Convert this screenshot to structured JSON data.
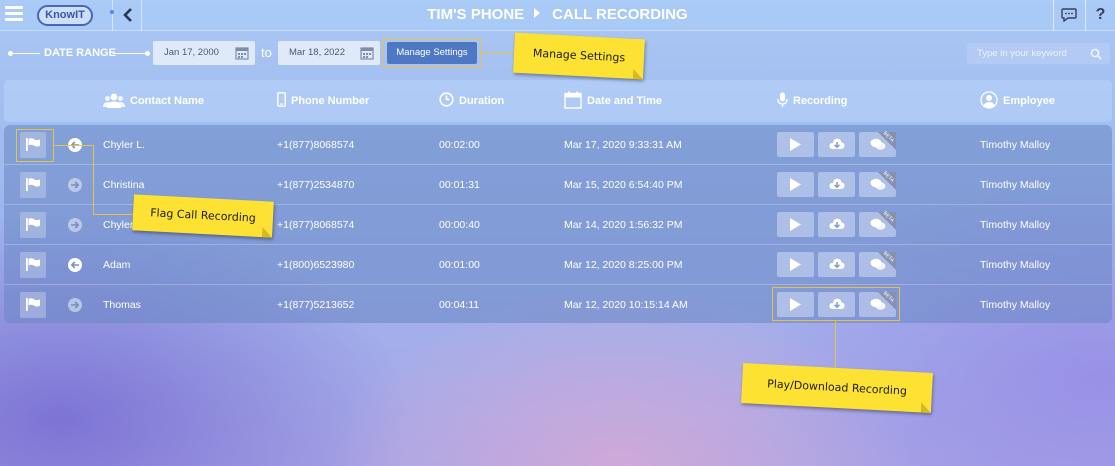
{
  "app": {
    "logo_text": "KnowIT"
  },
  "header": {
    "device": "TIM'S PHONE",
    "page": "CALL RECORDING",
    "help_label": "?"
  },
  "filters": {
    "range_label": "DATE RANGE",
    "from_date": "Jan 17, 2000",
    "to_label": "to",
    "to_date": "Mar 18, 2022",
    "manage_label": "Manage Settings",
    "search_placeholder": "Type in your keyword"
  },
  "columns": {
    "contact": "Contact Name",
    "phone": "Phone Number",
    "duration": "Duration",
    "datetime": "Date and Time",
    "recording": "Recording",
    "employee": "Employee"
  },
  "rows": [
    {
      "contact": "Chyler L.",
      "phone": "+1(877)8068574",
      "duration": "00:02:00",
      "datetime": "Mar 17, 2020 9:33:31 AM",
      "employee": "Timothy Malloy",
      "direction": "incoming"
    },
    {
      "contact": "Christina",
      "phone": "+1(877)2534870",
      "duration": "00:01:31",
      "datetime": "Mar 15, 2020 6:54:40 PM",
      "employee": "Timothy Malloy",
      "direction": "outgoing"
    },
    {
      "contact": "Chyler L.",
      "phone": "+1(877)8068574",
      "duration": "00:00:40",
      "datetime": "Mar 14, 2020 1:56:32 PM",
      "employee": "Timothy Malloy",
      "direction": "outgoing"
    },
    {
      "contact": "Adam",
      "phone": "+1(800)6523980",
      "duration": "00:01:00",
      "datetime": "Mar 12, 2020 8:25:00 PM",
      "employee": "Timothy Malloy",
      "direction": "incoming"
    },
    {
      "contact": "Thomas",
      "phone": "+1(877)5213652",
      "duration": "00:04:11",
      "datetime": "Mar 12, 2020 10:15:14 AM",
      "employee": "Timothy Malloy",
      "direction": "outgoing"
    }
  ],
  "beta_label": "BETA",
  "annotations": {
    "manage": "Manage Settings",
    "flag": "Flag Call Recording",
    "play": "Play/Download Recording"
  },
  "colors": {
    "accent": "#4f78c4",
    "note": "#fde233",
    "outline": "#e7c24a"
  }
}
